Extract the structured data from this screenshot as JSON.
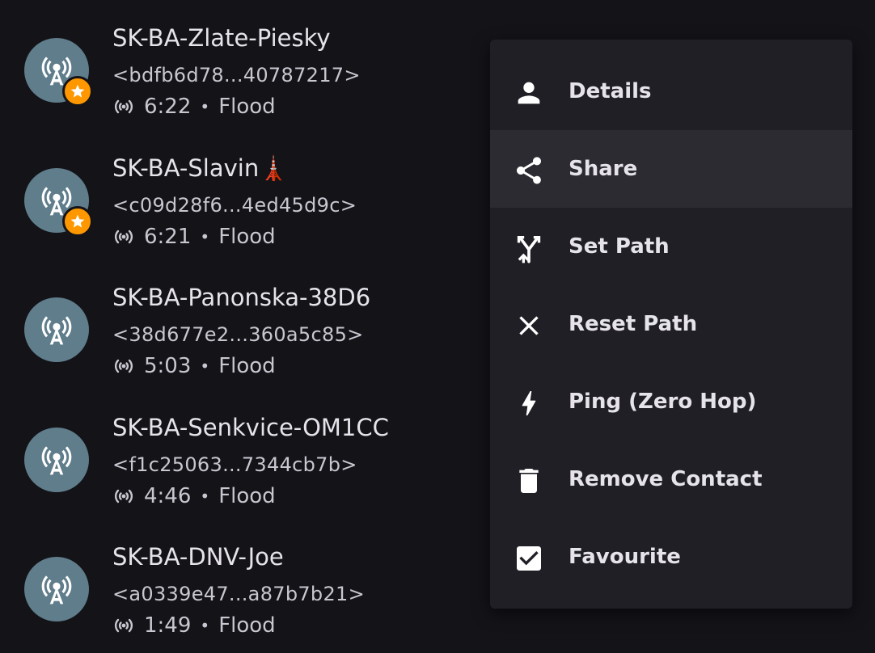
{
  "contacts": [
    {
      "name": "SK-BA-Zlate-Piesky",
      "key": "<bdfb6d78...40787217>",
      "time": "6:22",
      "route": "Flood",
      "favourite": true
    },
    {
      "name": "SK-BA-Slavin🗼",
      "key": "<c09d28f6...4ed45d9c>",
      "time": "6:21",
      "route": "Flood",
      "favourite": true
    },
    {
      "name": "SK-BA-Panonska-38D6",
      "key": "<38d677e2...360a5c85>",
      "time": "5:03",
      "route": "Flood",
      "favourite": false
    },
    {
      "name": "SK-BA-Senkvice-OM1CC",
      "key": "<f1c25063...7344cb7b>",
      "time": "4:46",
      "route": "Flood",
      "favourite": false
    },
    {
      "name": "SK-BA-DNV-Joe",
      "key": "<a0339e47...a87b7b21>",
      "time": "1:49",
      "route": "Flood",
      "favourite": false
    }
  ],
  "separator": "•",
  "menu": {
    "items": [
      {
        "label": "Details",
        "icon": "person-icon"
      },
      {
        "label": "Share",
        "icon": "share-icon",
        "highlighted": true
      },
      {
        "label": "Set Path",
        "icon": "fork-path-icon"
      },
      {
        "label": "Reset Path",
        "icon": "close-icon"
      },
      {
        "label": "Ping (Zero Hop)",
        "icon": "bolt-icon"
      },
      {
        "label": "Remove Contact",
        "icon": "trash-icon"
      },
      {
        "label": "Favourite",
        "icon": "checkbox-checked-icon",
        "checked": true
      }
    ]
  },
  "colors": {
    "background": "#131318",
    "avatar": "#607d8b",
    "star_badge": "#ff9800",
    "menu_background": "#211f26",
    "menu_highlight": "#2c2b31"
  }
}
